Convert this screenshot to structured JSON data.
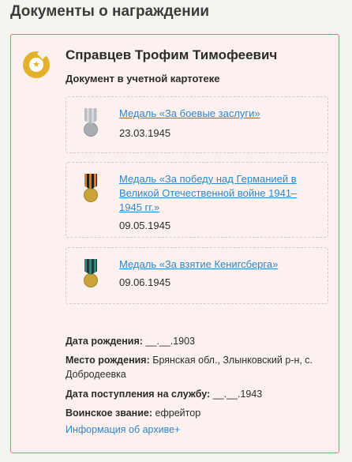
{
  "section_title": "Документы о награждении",
  "card": {
    "person_name": "Справцев Трофим Тимофеевич",
    "document_type": "Документ в учетной картотеке",
    "badge_icon": "star-badge-icon",
    "awards": [
      {
        "title": "Медаль «За боевые заслуги»",
        "date": "23.03.1945",
        "icon": "medal-combat-merit-icon",
        "ribbon_colors": [
          "#b9bcc0",
          "#d0d3d6"
        ],
        "disk_color": "#a9adb1"
      },
      {
        "title": "Медаль «За победу над Германией в Великой Отечественной войне 1941–1945 гг.»",
        "date": "09.05.1945",
        "icon": "medal-victory-over-germany-icon",
        "ribbon_colors": [
          "#e07b1a",
          "#1f1f1f"
        ],
        "disk_color": "#c9a23a"
      },
      {
        "title": "Медаль «За взятие Кенигсберга»",
        "date": "09.06.1945",
        "icon": "medal-capture-of-koenigsberg-icon",
        "ribbon_colors": [
          "#2a8a7a",
          "#1f3a36"
        ],
        "disk_color": "#c9a23a"
      }
    ],
    "info": {
      "birth_date_label": "Дата рождения:",
      "birth_date_value": "__.__.1903",
      "birth_place_label": "Место рождения:",
      "birth_place_value": "Брянская обл., Злынковский р-н, с. Добродеевка",
      "service_date_label": "Дата поступления на службу:",
      "service_date_value": "__.__.1943",
      "rank_label": "Воинское звание:",
      "rank_value": "ефрейтор"
    },
    "archive_link": "Информация об архиве+"
  },
  "colors": {
    "card_border": "#e07a75",
    "card_bg": "#fdf1f0",
    "link": "#2f86c8",
    "badge": "#e3b12a"
  }
}
